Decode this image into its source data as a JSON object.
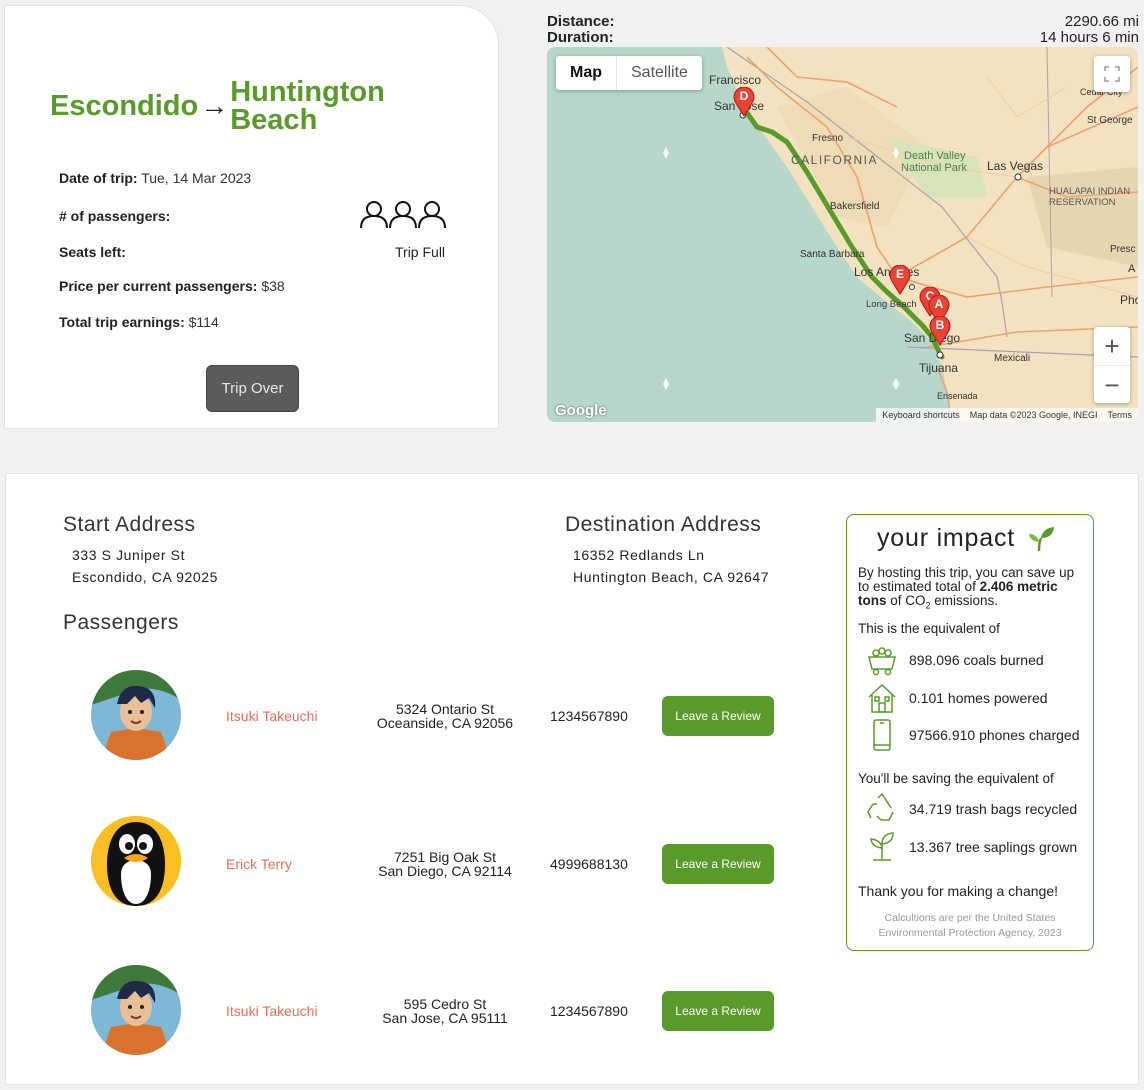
{
  "trip": {
    "origin": "Escondido",
    "arrow": "→",
    "destination_line1": "Huntington",
    "destination_line2": "Beach",
    "date_label": "Date of trip:",
    "date_value": "Tue, 14 Mar 2023",
    "passengers_label": "# of passengers:",
    "passenger_count": 3,
    "seats_label": "Seats left:",
    "seats_value": "Trip Full",
    "price_label": "Price per current passengers:",
    "price_value": "$38",
    "earnings_label": "Total trip earnings:",
    "earnings_value": "$114",
    "button_label": "Trip Over"
  },
  "route_summary": {
    "distance_label": "Distance:",
    "distance_value": "2290.66 mi",
    "duration_label": "Duration:",
    "duration_value": "14 hours 6 min"
  },
  "map": {
    "tab_map": "Map",
    "tab_satellite": "Satellite",
    "zoom_in": "+",
    "zoom_out": "−",
    "logo": "Google",
    "attribution": [
      "Keyboard shortcuts",
      "Map data ©2023 Google, INEGI",
      "Terms"
    ],
    "labels": {
      "sf": "Francisco",
      "sj": "San Jose",
      "fresno": "Fresno",
      "california": "CALIFORNIA",
      "dv1": "Death Valley",
      "dv2": "National Park",
      "lv": "Las Vegas",
      "bakersfield": "Bakersfield",
      "sb": "Santa Barbara",
      "la": "Los Angeles",
      "lb": "Long Beach",
      "sd": "San Diego",
      "tj": "Tijuana",
      "mx": "Mexicali",
      "en": "Ensenada",
      "hual1": "HUALAPAI INDIAN",
      "hual2": "RESERVATION",
      "cedar": "Cedar City",
      "stg": "St George",
      "presc": "Presc",
      "phx": "Pho",
      "aa": "A"
    },
    "markers": [
      "A",
      "B",
      "C",
      "D",
      "E"
    ],
    "route_color": "#5a9a2a"
  },
  "details": {
    "start_heading": "Start Address",
    "start_line1": "333 S Juniper St",
    "start_line2": "Escondido, CA 92025",
    "dest_heading": "Destination Address",
    "dest_line1": "16352 Redlands Ln",
    "dest_line2": "Huntington Beach, CA 92647",
    "passengers_heading": "Passengers",
    "review_label": "Leave a Review",
    "passengers": [
      {
        "name": "Itsuki Takeuchi",
        "addr1": "5324 Ontario St",
        "addr2": "Oceanside, CA 92056",
        "phone": "1234567890"
      },
      {
        "name": "Erick Terry",
        "addr1": "7251 Big Oak St",
        "addr2": "San Diego, CA 92114",
        "phone": "4999688130"
      },
      {
        "name": "Itsuki Takeuchi",
        "addr1": "595 Cedro St",
        "addr2": "San Jose, CA 95111",
        "phone": "1234567890"
      }
    ]
  },
  "impact": {
    "title": "your impact",
    "intro_a": "By hosting this trip, you can save up",
    "intro_b": "to estimated total of ",
    "intro_bold1": "2.406 metric",
    "intro_bold2": "tons",
    "intro_c": " of CO",
    "intro_sub": "2",
    "intro_d": " emissions.",
    "equiv_heading": "This is the equivalent of",
    "coals": "898.096 coals burned",
    "homes": "0.101 homes powered",
    "phones": "97566.910 phones charged",
    "saving_heading": "You'll be saving the equivalent of",
    "trash": "34.719 trash bags recycled",
    "trees": "13.367 tree saplings grown",
    "thanks": "Thank you for making a change!",
    "footnote1": "Calcultions are per the United States",
    "footnote2": "Environmental Protection Agency, 2023",
    "accent": "#5a9a2a"
  }
}
